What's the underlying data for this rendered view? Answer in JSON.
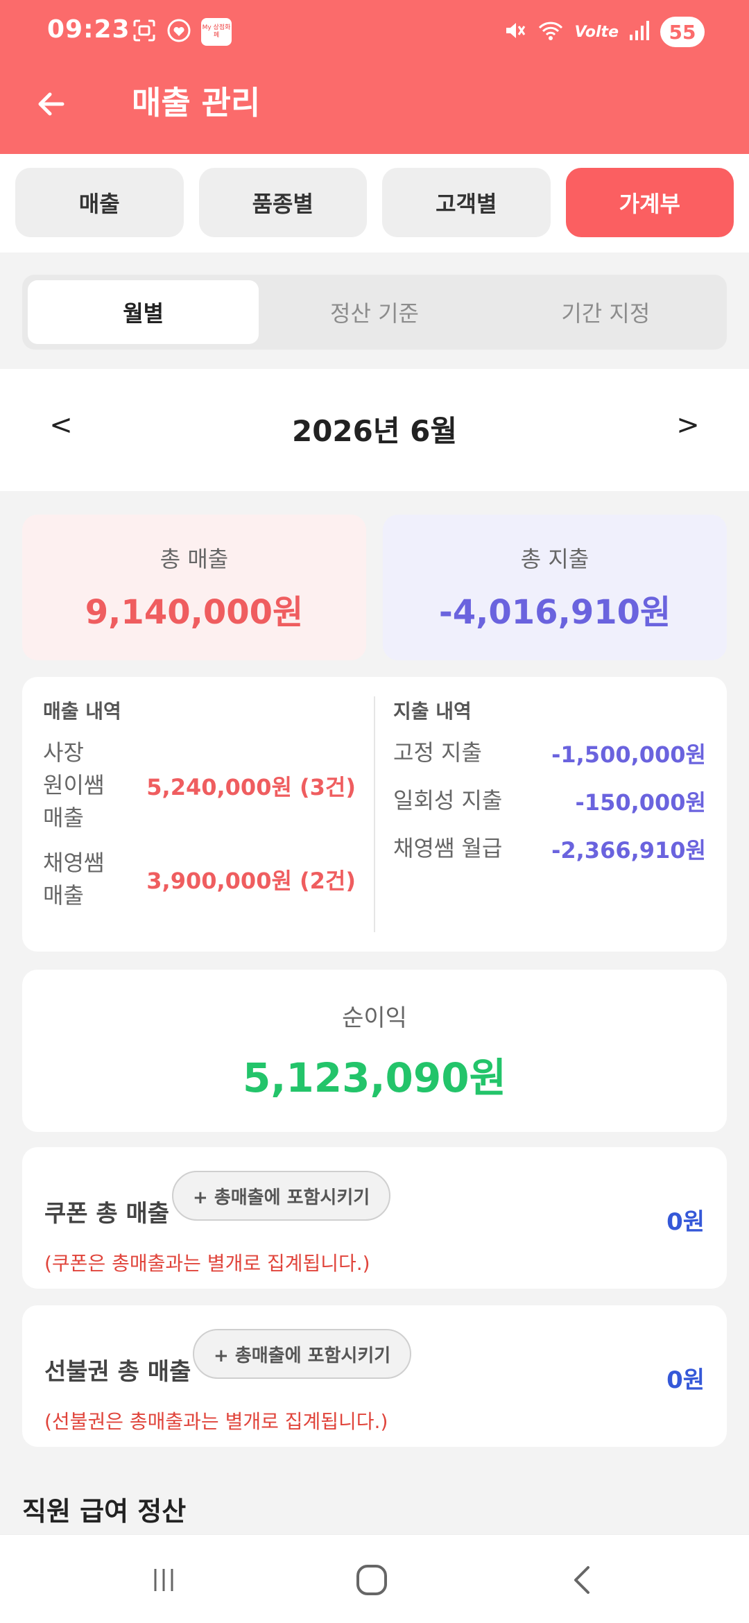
{
  "status": {
    "time": "09:23",
    "battery": "55",
    "network": "Volte",
    "app_badge": "My 상점화폐"
  },
  "header": {
    "title": "매출 관리"
  },
  "tabs": [
    {
      "label": "매출",
      "active": false
    },
    {
      "label": "품종별",
      "active": false
    },
    {
      "label": "고객별",
      "active": false
    },
    {
      "label": "가계부",
      "active": true
    }
  ],
  "segments": [
    {
      "label": "월별",
      "active": true
    },
    {
      "label": "정산 기준",
      "active": false
    },
    {
      "label": "기간 지정",
      "active": false
    }
  ],
  "month_nav": {
    "prev": "<",
    "label": "2026년 6월",
    "next": ">"
  },
  "summary": {
    "sales_label": "총 매출",
    "sales_value": "9,140,000원",
    "expense_label": "총 지출",
    "expense_value": "-4,016,910원"
  },
  "breakdown": {
    "sales_title": "매출 내역",
    "sales_items": [
      {
        "name_lines": [
          "사장",
          "원이쌤",
          "매출"
        ],
        "value": "5,240,000원 (3건)"
      },
      {
        "name_lines": [
          "채영쌤",
          "매출"
        ],
        "value": "3,900,000원 (2건)"
      }
    ],
    "expense_title": "지출 내역",
    "expense_items": [
      {
        "name": "고정 지출",
        "value": "-1,500,000원"
      },
      {
        "name": "일회성 지출",
        "value": "-150,000원"
      },
      {
        "name": "채영쌤 월급",
        "value": "-2,366,910원"
      }
    ]
  },
  "net_profit": {
    "label": "순이익",
    "value": "5,123,090원"
  },
  "coupon": {
    "title": "쿠폰 총 매출",
    "button": "+ 총매출에 포함시키기",
    "value": "0원",
    "note": "(쿠폰은 총매출과는 별개로 집계됩니다.)"
  },
  "prepaid": {
    "title": "선불권 총 매출",
    "button": "+ 총매출에 포함시키기",
    "value": "0원",
    "note": "(선불권은 총매출과는 별개로 집계됩니다.)"
  },
  "staff_section": {
    "title": "직원 급여 정산"
  },
  "colors": {
    "brand_red": "#fb6b6b",
    "active_tab": "#fb5f61",
    "sales_red": "#ef5d5f",
    "expense_purple": "#6a63de",
    "profit_green": "#23c46a",
    "value_blue": "#3558d8",
    "note_red": "#e0443b"
  },
  "icons": {
    "back": "arrow-left-icon",
    "nav_recent": "recent-apps-icon",
    "nav_home": "home-icon",
    "nav_back": "back-icon"
  }
}
